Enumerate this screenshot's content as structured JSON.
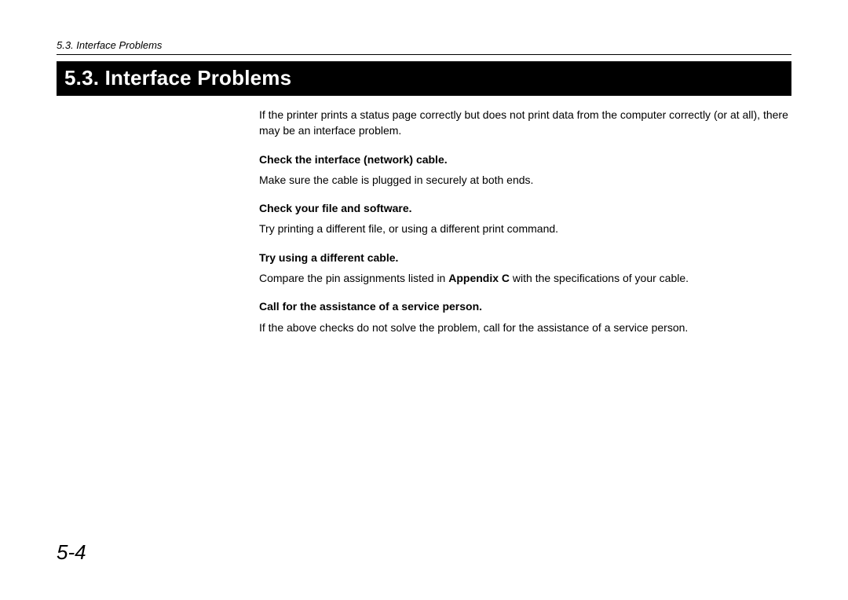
{
  "header": {
    "running": "5.3.  Interface Problems"
  },
  "section": {
    "title": "5.3. Interface Problems"
  },
  "body": {
    "intro": "If the printer prints a status page correctly but does not print data from the computer correctly (or at all), there may be an interface problem.",
    "items": [
      {
        "heading": "Check the interface (network) cable.",
        "text": "Make sure the cable is plugged in securely at both ends."
      },
      {
        "heading": "Check your file and software.",
        "text": "Try printing a different file, or using a different print command."
      },
      {
        "heading": "Try using a different cable.",
        "text_before": "Compare the pin assignments listed in ",
        "text_bold": "Appendix C",
        "text_after": " with the specifications of your cable."
      },
      {
        "heading": "Call for the assistance of a service person.",
        "text": "If the above checks do not solve the problem, call for the assistance of a service person."
      }
    ]
  },
  "page_number": "5-4"
}
